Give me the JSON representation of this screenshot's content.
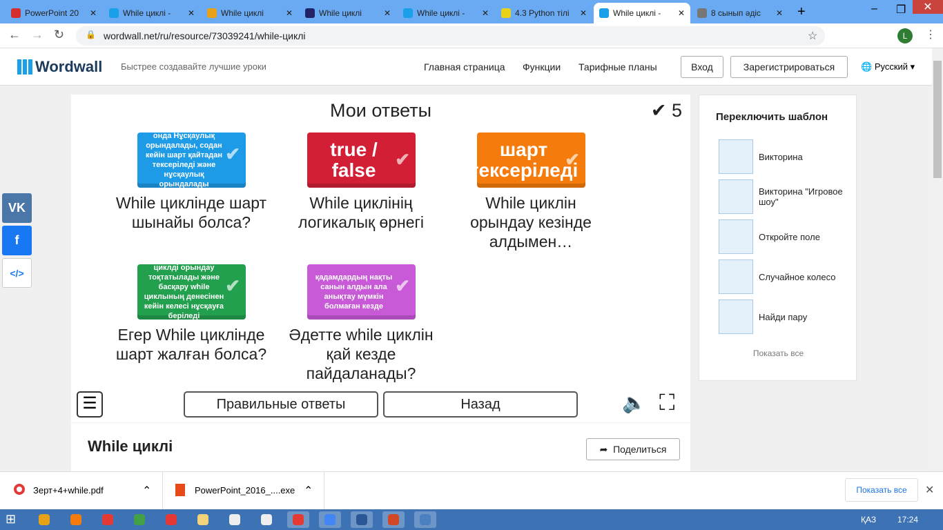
{
  "browser": {
    "tabs": [
      {
        "title": "PowerPoint 20",
        "color": "#d32f2f"
      },
      {
        "title": "While циклі - ",
        "color": "#1aa0e8"
      },
      {
        "title": "While циклі",
        "color": "#e8a21a"
      },
      {
        "title": "While циклі",
        "color": "#222266"
      },
      {
        "title": "While циклі - ",
        "color": "#1aa0e8"
      },
      {
        "title": "4.3 Python тілі",
        "color": "#e8d21a"
      },
      {
        "title": "While циклі - ",
        "color": "#1aa0e8"
      },
      {
        "title": "8 сынып әдіс",
        "color": "#777777"
      }
    ],
    "active_tab": 6,
    "url": "wordwall.net/ru/resource/73039241/while-циклі",
    "profile_initial": "L"
  },
  "site": {
    "logo": "Wordwall",
    "tagline": "Быстрее создавайте лучшие уроки",
    "nav": [
      "Главная страница",
      "Функции",
      "Тарифные планы"
    ],
    "login": "Вход",
    "register": "Зарегистрироваться",
    "language": "Русский"
  },
  "game": {
    "title": "Мои ответы",
    "score": "5",
    "cards": [
      {
        "answer": "онда Нұсқаулық орындалады, содан кейін шарт қайтадан тексеріледі және нұсқаулық орындалады",
        "question": "While циклінде шарт шынайы болса?",
        "color": "#1e9be6"
      },
      {
        "answer": "true / false",
        "question": "While циклінің логикалық өрнегі",
        "color": "#d21f35"
      },
      {
        "answer": "шарт тексеріледі",
        "question": "While циклін орындау кезінде алдымен…",
        "color": "#f57c0c"
      },
      {
        "answer": "циклді орындау тоқтатылады және басқару while циклының денесінен кейін келесі нұсқауға беріледі",
        "question": "Егер While циклінде шарт жалған болса?",
        "color": "#23a04e"
      },
      {
        "answer": "қадамдардың нақты санын алдын ала анықтау мүмкін болмаған кезде",
        "question": "Әдетте while циклін қай кезде пайдаланады?",
        "color": "#c85ad8"
      }
    ],
    "correct_answers": "Правильные ответы",
    "back": "Назад"
  },
  "social": [
    "VK",
    "f",
    "</>"
  ],
  "panel": {
    "title": "Переключить шаблон",
    "templates": [
      "Викторина",
      "Викторина \"Игровое шоу\"",
      "Откройте поле",
      "Случайное колесо",
      "Найди пару"
    ],
    "show_all": "Показать все"
  },
  "activity": {
    "title": "While циклі",
    "share": "Поделиться"
  },
  "downloads": {
    "items": [
      "Зерт+4+while.pdf",
      "PowerPoint_2016_....exe"
    ],
    "show_all": "Показать все"
  },
  "taskbar": {
    "lang": "ҚАЗ",
    "time": "17:24"
  }
}
